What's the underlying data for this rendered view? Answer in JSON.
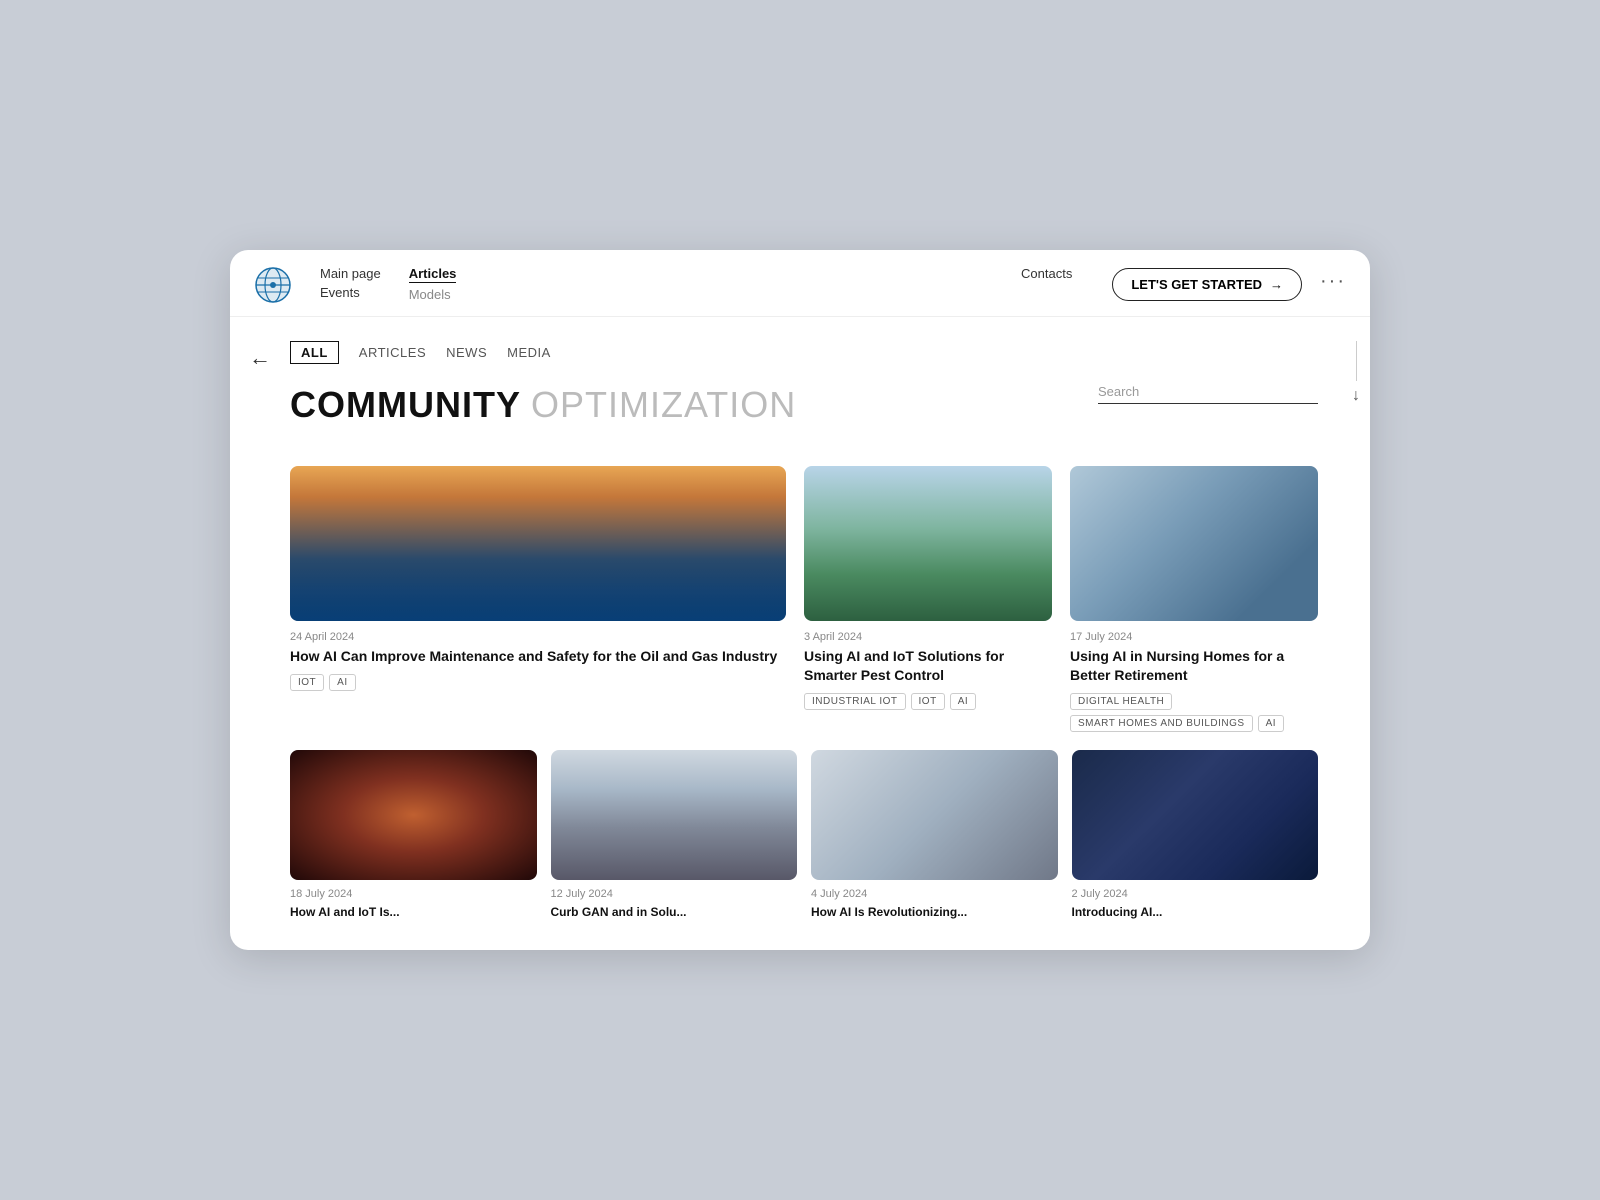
{
  "nav": {
    "logo_alt": "Globe logo",
    "links_col1": [
      {
        "label": "Main page",
        "active": false
      },
      {
        "label": "Events",
        "active": false
      }
    ],
    "links_col2": [
      {
        "label": "Articles",
        "active": true
      },
      {
        "label": "Models",
        "active": false
      }
    ],
    "links_col3": [
      {
        "label": "Contacts",
        "active": false
      }
    ],
    "cta_label": "LET'S GET STARTED",
    "dots": "···"
  },
  "filter": {
    "tabs": [
      {
        "label": "ALL",
        "active": true
      },
      {
        "label": "ARTICLES",
        "active": false
      },
      {
        "label": "NEWS",
        "active": false
      },
      {
        "label": "MEDIA",
        "active": false
      }
    ]
  },
  "heading": {
    "bold": "COMMUNITY",
    "light": "OPTIMIZATION"
  },
  "search": {
    "placeholder": "Search"
  },
  "articles_top": [
    {
      "date": "24 April 2024",
      "title": "How AI Can Improve Maintenance and Safety for the Oil and Gas Industry",
      "tags": [
        "IOT",
        "AI"
      ],
      "image_class": "img-ship"
    },
    {
      "date": "3 April 2024",
      "title": "Using AI and IoT Solutions for Smarter Pest Control",
      "tags": [
        "INDUSTRIAL IOT",
        "IOT",
        "AI"
      ],
      "image_class": "img-drone"
    },
    {
      "date": "17 July 2024",
      "title": "Using AI in Nursing Homes for a Better Retirement",
      "tags": [
        "DIGITAL HEALTH",
        "SMART HOMES AND BUILDINGS",
        "AI"
      ],
      "image_class": "img-nursing"
    }
  ],
  "articles_bottom": [
    {
      "date": "18 July 2024",
      "title": "How AI and IoT Is...",
      "image_class": "img-hand"
    },
    {
      "date": "12 July 2024",
      "title": "Curb GAN and in Solu...",
      "image_class": "img-city"
    },
    {
      "date": "4 July 2024",
      "title": "How AI Is Revolutionizing...",
      "image_class": "img-woman"
    },
    {
      "date": "2 July 2024",
      "title": "Introducing AI...",
      "image_class": "img-chip"
    }
  ]
}
